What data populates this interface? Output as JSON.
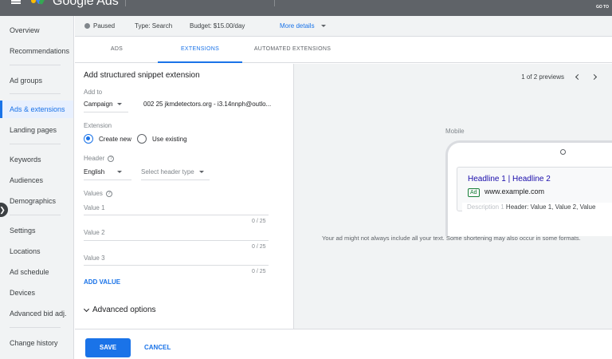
{
  "app": {
    "title": "Google Ads",
    "goto_label": "GO TO"
  },
  "sidebar": {
    "items": [
      {
        "label": "Overview"
      },
      {
        "label": "Recommendations"
      },
      {
        "label": "Ad groups"
      },
      {
        "label": "Ads & extensions"
      },
      {
        "label": "Landing pages"
      },
      {
        "label": "Keywords"
      },
      {
        "label": "Audiences"
      },
      {
        "label": "Demographics"
      },
      {
        "label": "Settings"
      },
      {
        "label": "Locations"
      },
      {
        "label": "Ad schedule"
      },
      {
        "label": "Devices"
      },
      {
        "label": "Advanced bid adj."
      },
      {
        "label": "Change history"
      }
    ],
    "active": "Ads & extensions"
  },
  "status": {
    "state": "Paused",
    "type": "Type: Search",
    "budget": "Budget: $15.00/day",
    "more_details": "More details"
  },
  "tabs": [
    {
      "label": "ADS"
    },
    {
      "label": "EXTENSIONS"
    },
    {
      "label": "AUTOMATED EXTENSIONS"
    }
  ],
  "active_tab": "EXTENSIONS",
  "form": {
    "title": "Add structured snippet extension",
    "add_to_label": "Add to",
    "add_to_value": "Campaign",
    "campaign_name": "002 25 jkmdetectors.org - i3.14nnph@outlo...",
    "extension_label": "Extension",
    "create_new": "Create new",
    "use_existing": "Use existing",
    "header_label": "Header",
    "language_value": "English",
    "header_type_placeholder": "Select header type",
    "values_label": "Values",
    "value_fields": [
      {
        "label": "Value 1",
        "counter": "0 / 25"
      },
      {
        "label": "Value 2",
        "counter": "0 / 25"
      },
      {
        "label": "Value 3",
        "counter": "0 / 25"
      }
    ],
    "add_value": "ADD VALUE",
    "advanced_options": "Advanced options"
  },
  "preview": {
    "pager": "1 of 2 previews",
    "device": "Mobile",
    "headline": "Headline 1 | Headline 2",
    "ad_badge": "Ad",
    "display_url": "www.example.com",
    "description_placeholder": "Description 1",
    "snippet_text": "Header: Value 1, Value 2, Value",
    "note": "Your ad might not always include all your text. Some shortening may also occur in some formats."
  },
  "footer": {
    "save": "SAVE",
    "cancel": "CANCEL"
  },
  "colors": {
    "accent": "#1a73e8",
    "topbar": "#5f6368",
    "url_green": "#188038",
    "headline": "#1a0dab"
  }
}
